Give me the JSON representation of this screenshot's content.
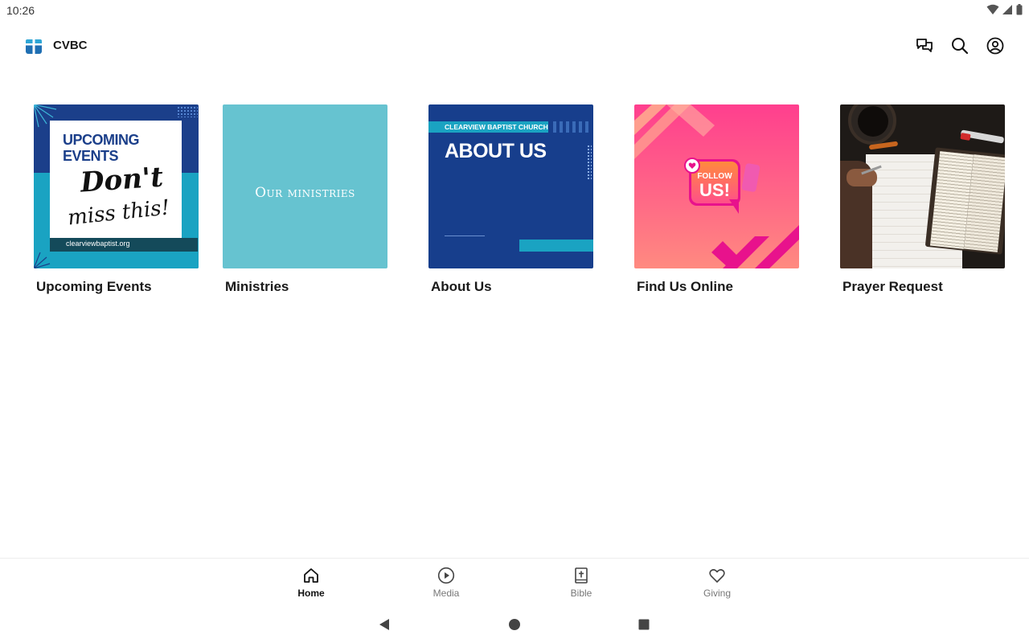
{
  "status_bar": {
    "time": "10:26",
    "icons": [
      "wifi-icon",
      "cell-signal-icon",
      "battery-icon"
    ]
  },
  "app_bar": {
    "title": "CVBC",
    "logo_icon": "church-logo-icon",
    "actions": [
      "chat-icon",
      "search-icon",
      "account-icon"
    ]
  },
  "tiles": [
    {
      "label": "Upcoming Events",
      "image_text": {
        "heading": "UPCOMING EVENTS",
        "script_line1": "Don't",
        "script_line2": "miss this!",
        "website": "clearviewbaptist.org"
      }
    },
    {
      "label": "Ministries",
      "image_text": {
        "heading": "Our ministries"
      }
    },
    {
      "label": "About Us",
      "image_text": {
        "banner": "CLEARVIEW BAPTIST CHURCH",
        "heading": "ABOUT US"
      }
    },
    {
      "label": "Find Us Online",
      "image_text": {
        "line1": "FOLLOW",
        "line2": "US!"
      }
    },
    {
      "label": "Prayer Request",
      "image_text": {}
    }
  ],
  "bottom_nav": {
    "items": [
      {
        "label": "Home",
        "icon": "home-icon",
        "active": true
      },
      {
        "label": "Media",
        "icon": "play-circle-icon",
        "active": false
      },
      {
        "label": "Bible",
        "icon": "bible-icon",
        "active": false
      },
      {
        "label": "Giving",
        "icon": "heart-icon",
        "active": false
      }
    ]
  },
  "system_nav": [
    "back-icon",
    "home-circle-icon",
    "recents-icon"
  ],
  "colors": {
    "navy": "#1b3f8a",
    "teal": "#1aa3c2",
    "ministries_bg": "#66c3d0",
    "about_bg": "#173e8c",
    "pink": "#ff4f8a",
    "magenta": "#e8128c"
  }
}
